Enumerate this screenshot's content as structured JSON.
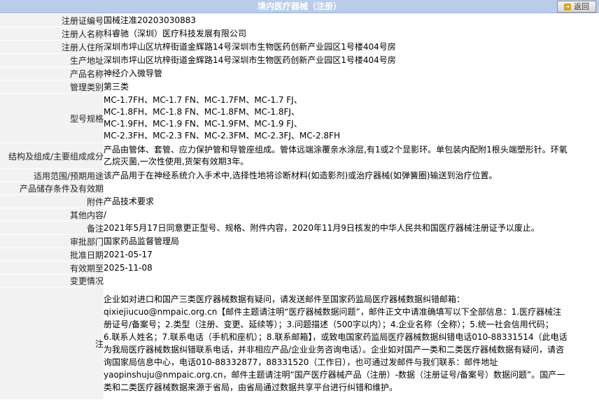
{
  "header": {
    "title": "境内医疗器械（注册）",
    "back_label": "返回"
  },
  "rows": [
    {
      "label": "注册证编号",
      "value": "国械注准20203030883"
    },
    {
      "label": "注册人名称",
      "value": "科睿驰（深圳）医疗科技发展有限公司"
    },
    {
      "label": "注册人住所",
      "value": "深圳市坪山区坑梓街道金辉路14号深圳市生物医药创新产业园区1号楼404号房"
    },
    {
      "label": "生产地址",
      "value": "深圳市坪山区坑梓街道金辉路14号深圳市生物医药创新产业园区1号楼404号房"
    },
    {
      "label": "产品名称",
      "value": "神经介入微导管"
    },
    {
      "label": "管理类别",
      "value": "第三类"
    }
  ],
  "models": {
    "label": "型号规格",
    "lines": [
      "MC-1.7FH、MC-1.7 FN、MC-1.7FM、MC-1.7 FJ、",
      "MC-1.8FH、MC-1.8 FN、MC-1.8FM、MC-1.8FJ、",
      "MC-1.9FH、MC-1.9 FN、MC-1.9FM、MC-1.9 FJ、",
      "MC-2.3FH、MC-2.3 FN、MC-2.3FM、MC-2.3FJ、MC-2.8FH"
    ]
  },
  "structure": {
    "label": "结构及组成/主要组成成分",
    "lines": [
      "产品由管体、套管、应力保护管和导管座组成。管体远端涂覆亲水涂层,有1或2个显影环。单包装内配附1根头端塑形针。环氧",
      "乙烷灭菌,一次性使用,货架有效期3年。"
    ]
  },
  "rows2": [
    {
      "label": "适用范围/预期用途",
      "value": "该产品用于在神经系统介入手术中,选择性地将诊断材料(如造影剂)或治疗器械(如弹簧圈)输送到治疗位置。"
    },
    {
      "label": "产品储存条件及有效期",
      "value": ""
    },
    {
      "label": "附件",
      "value": "产品技术要求"
    },
    {
      "label": "其他内容",
      "value": "/"
    },
    {
      "label": "备注",
      "value": "2021年5月17日同意更正型号、规格、附件内容，2020年11月9日核发的中华人民共和国医疗器械注册证予以废止。"
    },
    {
      "label": "审批部门",
      "value": "国家药品监督管理局"
    },
    {
      "label": "批准日期",
      "value": "2021-05-17"
    },
    {
      "label": "有效期至",
      "value": "2025-11-08"
    },
    {
      "label": "变更情况",
      "value": ""
    }
  ],
  "note": {
    "label": "注",
    "lines": [
      "企业如对进口和国产三类医疗器械数据有疑问，请发送邮件至国家药监局医疗器械数据纠错邮箱：",
      "qixiejiucuo@nmpaic.org.cn【邮件主题请注明“医疗器械数据问题”，邮件正文中请准确填写以下全部信息：1.医疗器械注",
      "册证号/备案号；2.类型（注册、变更、延续等）；3.问题描述（500字以内）；4.企业名称（全称）；5.统一社会信用代码；",
      "6.联系人姓名；7.联系电话（手机和座机）；8.联系邮箱】，或致电国家药监局医疗器械数据纠错电话010-88331514（此电话",
      "为我局医疗器械数据纠错联系电话，并非相应产品/企业业务咨询电话）。企业如对国产一类和二类医疗器械数据有疑问，请咨",
      "询国家局信息中心，电话010-88332877，88331520（工作日），也可通过发邮件与我们联系：邮件地址",
      "yaopinshuju@nmpaic.org.cn，邮件主题请注明“国产医疗器械产品（注册）-数据（注册证号/备案号）数据问题”。国产一",
      "类和二类医疗器械数据来源于省局，由省局通过数据共享平台进行纠错和维护。"
    ]
  }
}
